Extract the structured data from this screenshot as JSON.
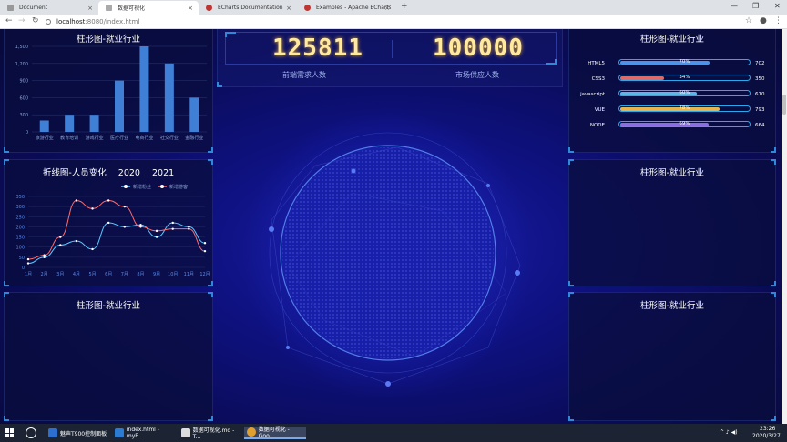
{
  "browser": {
    "tabs": [
      {
        "title": "Document",
        "close": "×",
        "color": "#888888"
      },
      {
        "title": "数据可视化",
        "close": "×",
        "color": "#888888"
      },
      {
        "title": "ECharts Documentation",
        "close": "×",
        "color": "#c23531"
      },
      {
        "title": "Examples - Apache ECharts (in",
        "close": "×",
        "color": "#c23531"
      }
    ],
    "new_tab": "+",
    "window_controls": [
      "—",
      "❐",
      "✕"
    ],
    "url_host": "localhost",
    "url_path": ":8080/index.html",
    "nav": {
      "back": "←",
      "forward": "→",
      "reload": "↻"
    },
    "star": "☆",
    "profile": "●",
    "menu": "⋮"
  },
  "dashboard": {
    "top_left_title": "柱形图-就业行业",
    "line_title": "折线图-人员变化",
    "line_years": [
      "2020",
      "2021"
    ],
    "bottom_left_title": "柱形图-就业行业",
    "right_top_title": "柱形图-就业行业",
    "right_mid_title": "柱形图-就业行业",
    "right_bottom_title": "柱形图-就业行业",
    "center_numbers": [
      "125811",
      "100000"
    ],
    "center_labels": [
      "前端需求人数",
      "市场供应人数"
    ]
  },
  "chart_data": [
    {
      "type": "bar",
      "title": "柱形图-就业行业",
      "categories": [
        "旅游行业",
        "教育培训",
        "游戏行业",
        "医疗行业",
        "电商行业",
        "社交行业",
        "金融行业"
      ],
      "values": [
        200,
        300,
        300,
        900,
        1500,
        1200,
        600
      ],
      "yticks": [
        "0",
        "300",
        "600",
        "900",
        "1,200",
        "1,500"
      ],
      "ylim": [
        0,
        1500
      ],
      "color": "#3f7fd6"
    },
    {
      "type": "line",
      "title": "折线图-人员变化",
      "categories": [
        "1月",
        "2月",
        "3月",
        "4月",
        "5月",
        "6月",
        "7月",
        "8月",
        "9月",
        "10月",
        "11月",
        "12月"
      ],
      "yticks": [
        "0",
        "50",
        "100",
        "150",
        "200",
        "250",
        "300",
        "350"
      ],
      "ylim": [
        0,
        350
      ],
      "series": [
        {
          "name": "新增粉丝",
          "color": "#58c8ff",
          "values": [
            20,
            50,
            110,
            130,
            90,
            220,
            200,
            210,
            150,
            220,
            200,
            120
          ]
        },
        {
          "name": "新增游客",
          "color": "#ff6a6a",
          "values": [
            40,
            60,
            150,
            330,
            290,
            330,
            300,
            200,
            180,
            190,
            190,
            80
          ]
        }
      ]
    },
    {
      "type": "bar",
      "title": "柱形图-就业行业",
      "rows": [
        {
          "label": "HTML5",
          "percent": "70%",
          "value": "702",
          "fraction": 0.7,
          "color": "#4f93e8"
        },
        {
          "label": "CSS3",
          "percent": "34%",
          "value": "350",
          "fraction": 0.34,
          "color": "#e06a6a"
        },
        {
          "label": "javascript",
          "percent": "60%",
          "value": "610",
          "fraction": 0.6,
          "color": "#5bb7e6"
        },
        {
          "label": "VUE",
          "percent": "78%",
          "value": "793",
          "fraction": 0.78,
          "color": "#e8b450"
        },
        {
          "label": "NODE",
          "percent": "69%",
          "value": "664",
          "fraction": 0.69,
          "color": "#8a6de0"
        }
      ]
    }
  ],
  "taskbar": {
    "items": [
      {
        "label": "魅声T900控制面板",
        "color": "#2c6fd1"
      },
      {
        "label": "index.html - myE...",
        "color": "#2b7bd3"
      },
      {
        "label": "数据可视化.md - T...",
        "color": "#dddddd"
      },
      {
        "label": "数据可视化 - Goo...",
        "color": "#e0a030"
      }
    ],
    "time": "23:26",
    "date": "2020/3/27",
    "tray": "^ ♪ ◀)"
  }
}
